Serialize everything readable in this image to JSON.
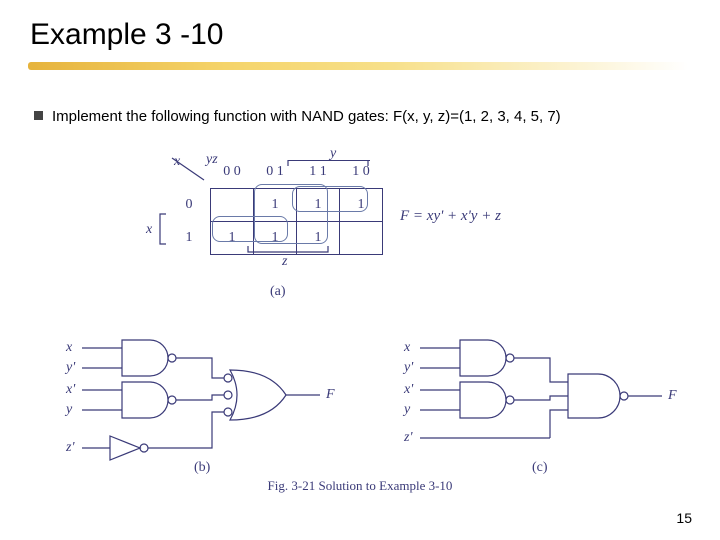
{
  "title": "Example 3 -10",
  "bullet_text": "Implement the following function with NAND gates: F(x, y, z)=(1, 2, 3, 4, 5, 7)",
  "kmap": {
    "row_var": "x",
    "col_var_pair": "yz",
    "col_var_top": "y",
    "col_headers": [
      "0 0",
      "0 1",
      "1 1",
      "1 0"
    ],
    "row_headers": [
      "0",
      "1"
    ],
    "x_label_for_row1": "x",
    "cells": [
      [
        "",
        "1",
        "1",
        "1"
      ],
      [
        "1",
        "1",
        "1",
        ""
      ]
    ],
    "bottom_var": "z",
    "sublabel": "(a)"
  },
  "function_eq": "F = xy' + x'y + z",
  "circuits": {
    "b": {
      "inputs": [
        "x",
        "y'",
        "x'",
        "y",
        "z'"
      ],
      "output": "F",
      "label": "(b)"
    },
    "c": {
      "inputs": [
        "x",
        "y'",
        "x'",
        "y",
        "z'"
      ],
      "output": "F",
      "label": "(c)"
    }
  },
  "figure_caption": "Fig. 3-21 Solution to Example 3-10",
  "page_number": "15"
}
